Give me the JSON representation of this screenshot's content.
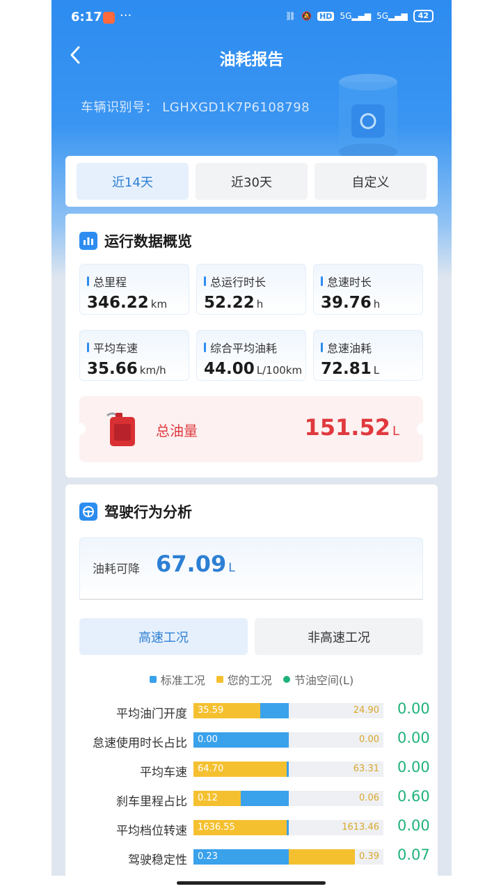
{
  "status_bar": {
    "time": "6:17",
    "dots": "···",
    "network_1": "5G",
    "network_2": "5G",
    "hd_label": "HD",
    "battery": "42"
  },
  "header": {
    "title": "油耗报告"
  },
  "vehicle": {
    "vin_label": "车辆识别号：",
    "vin": "LGHXGD1K7P6108798"
  },
  "period_tabs": [
    {
      "label": "近14天",
      "active": true
    },
    {
      "label": "近30天",
      "active": false
    },
    {
      "label": "自定义",
      "active": false
    }
  ],
  "overview": {
    "title": "运行数据概览",
    "stats": [
      {
        "label": "总里程",
        "value": "346.22",
        "unit": "km"
      },
      {
        "label": "总运行时长",
        "value": "52.22",
        "unit": "h"
      },
      {
        "label": "怠速时长",
        "value": "39.76",
        "unit": "h"
      },
      {
        "label": "平均车速",
        "value": "35.66",
        "unit": "km/h"
      },
      {
        "label": "综合平均油耗",
        "value": "44.00",
        "unit": "L/100km"
      },
      {
        "label": "怠速油耗",
        "value": "72.81",
        "unit": "L"
      }
    ],
    "total_fuel": {
      "label": "总油量",
      "value": "151.52",
      "unit": "L"
    }
  },
  "behavior": {
    "title": "驾驶行为分析",
    "reducible": {
      "label": "油耗可降",
      "value": "67.09",
      "unit": "L"
    },
    "condition_tabs": [
      {
        "label": "高速工况",
        "active": true
      },
      {
        "label": "非高速工况",
        "active": false
      }
    ],
    "legend": {
      "standard": "标准工况",
      "yours": "您的工况",
      "saving": "节油空间(L)"
    },
    "colors": {
      "standard": "#3aa1eb",
      "yours": "#f5c030",
      "saving": "#1fb27a"
    },
    "rows": [
      {
        "name": "平均油门开度",
        "yours": "35.59",
        "standard": "24.90",
        "saving": "0.00",
        "yours_frac": 0.35,
        "standard_frac": 0.5
      },
      {
        "name": "怠速使用时长占比",
        "yours": "0.00",
        "standard": "0.00",
        "saving": "0.00",
        "yours_frac": 0.0,
        "standard_frac": 0.5
      },
      {
        "name": "平均车速",
        "yours": "64.70",
        "standard": "63.31",
        "saving": "0.00",
        "yours_frac": 0.49,
        "standard_frac": 0.5
      },
      {
        "name": "刹车里程占比",
        "yours": "0.12",
        "standard": "0.06",
        "saving": "0.60",
        "yours_frac": 0.25,
        "standard_frac": 0.5
      },
      {
        "name": "平均档位转速",
        "yours": "1636.55",
        "standard": "1613.46",
        "saving": "0.00",
        "yours_frac": 0.49,
        "standard_frac": 0.5
      },
      {
        "name": "驾驶稳定性",
        "yours": "0.23",
        "standard": "0.39",
        "saving": "0.07",
        "yours_frac": 0.85,
        "standard_frac": 0.5
      }
    ]
  }
}
